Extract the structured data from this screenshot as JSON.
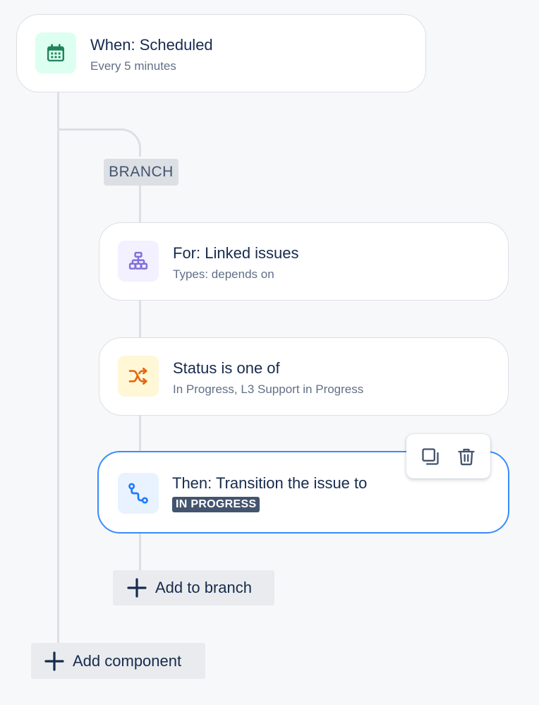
{
  "trigger": {
    "title": "When: Scheduled",
    "subtitle": "Every 5 minutes",
    "icon": "calendar-icon",
    "icon_bg": "#dcfff1",
    "icon_color": "#1f845a"
  },
  "branch": {
    "label": "BRANCH",
    "for_step": {
      "title": "For: Linked issues",
      "subtitle": "Types: depends on",
      "icon": "hierarchy-icon",
      "icon_bg": "#f3f0ff",
      "icon_color": "#8270db"
    },
    "condition_step": {
      "title": "Status is one of",
      "subtitle": "In Progress, L3 Support in Progress",
      "icon": "shuffle-icon",
      "icon_bg": "#fff7d6",
      "icon_color": "#e56910"
    },
    "action_step": {
      "title": "Then: Transition the issue to",
      "lozenge": "IN PROGRESS",
      "icon": "route-icon",
      "icon_bg": "#e9f2ff",
      "icon_color": "#1d7afc"
    },
    "add_label": "Add to branch"
  },
  "toolbar": {
    "duplicate_icon": "duplicate-icon",
    "delete_icon": "trash-icon"
  },
  "add_component_label": "Add component",
  "colors": {
    "selected_border": "#388bff",
    "connector": "#dcdfe4",
    "lozenge_bg": "#44546f"
  }
}
